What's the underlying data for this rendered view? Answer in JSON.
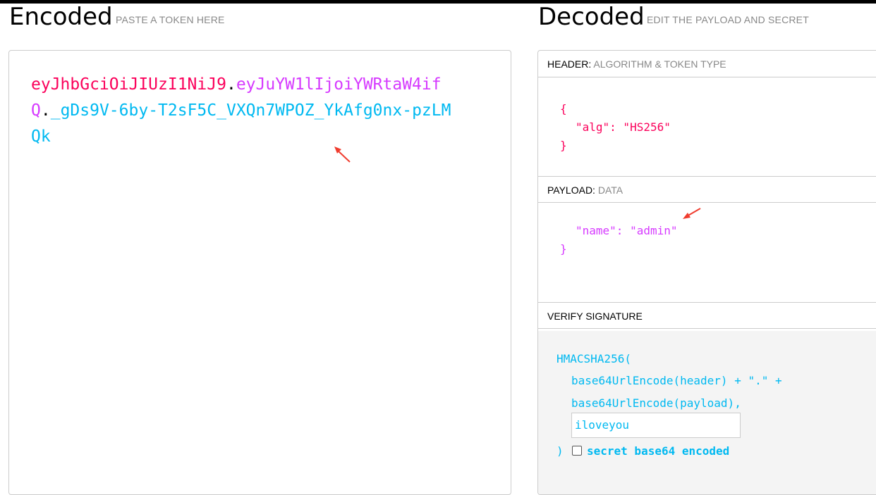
{
  "encoded": {
    "title": "Encoded",
    "subtitle": "PASTE A TOKEN HERE",
    "token_header": "eyJhbGciOiJIUzI1NiJ9",
    "token_payload": "eyJuYW1lIjoiYWRtaW4ifQ",
    "token_signature": "_gDs9V-6by-T2sF5C_VXQn7WPOZ_YkAfg0nx-pzLMQk",
    "dot": "."
  },
  "decoded": {
    "title": "Decoded",
    "subtitle": "EDIT THE PAYLOAD AND SECRET",
    "header_section": {
      "label": "HEADER:",
      "sublabel": "ALGORITHM & TOKEN TYPE",
      "open_brace": "{",
      "line": "\"alg\": \"HS256\"",
      "close_brace": "}"
    },
    "payload_section": {
      "label": "PAYLOAD:",
      "sublabel": "DATA",
      "line": "\"name\": \"admin\"",
      "close_brace": "}"
    },
    "verify_section": {
      "label": "VERIFY SIGNATURE",
      "line1": "HMACSHA256(",
      "line2": "base64UrlEncode(header) + \".\" +",
      "line3": "base64UrlEncode(payload),",
      "secret_value": "iloveyou",
      "close_paren": ")",
      "checkbox_label": "secret base64 encoded"
    }
  },
  "colors": {
    "header": "#fb015b",
    "payload": "#d63aff",
    "signature": "#00b9f1",
    "annotation_arrow": "#f03c2e"
  }
}
